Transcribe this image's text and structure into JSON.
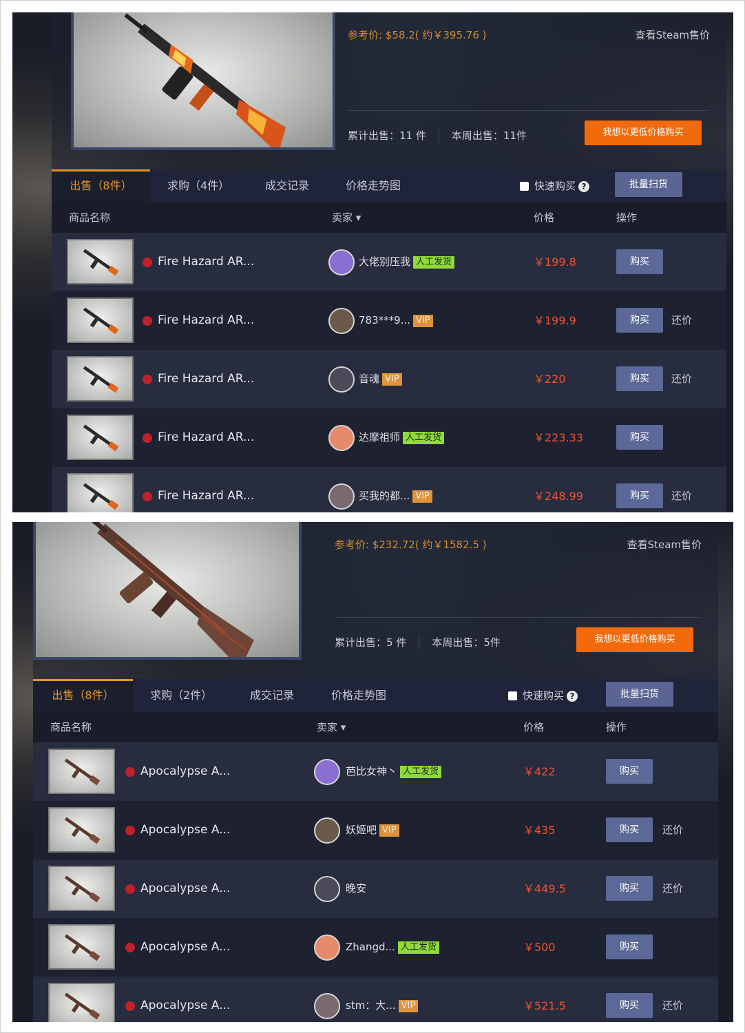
{
  "panel1": {
    "ref_price": "参考价: $58.2( 约￥395.76 )",
    "steam_link": "查看Steam售价",
    "total_sold": "累计出售：11 件",
    "week_sold": "本周出售：11件",
    "lowprice_btn": "我想以更低价格购买",
    "tabs": [
      "出售（8件）",
      "求购（4件）",
      "成交记录",
      "价格走势图"
    ],
    "quick_buy": "快速购买",
    "batch_btn": "批量扫货",
    "headers": {
      "name": "商品名称",
      "seller": "卖家 ▾",
      "price": "价格",
      "action": "操作"
    },
    "rows": [
      {
        "name": "Fire Hazard AR...",
        "seller": "大佬别压我",
        "badge": "人工发货",
        "badge_type": "manual",
        "price": "￥199.8",
        "buy": "购买",
        "haggle": ""
      },
      {
        "name": "Fire Hazard AR...",
        "seller": "783***9...",
        "badge": "VIP",
        "badge_type": "vip",
        "price": "￥199.9",
        "buy": "购买",
        "haggle": "还价"
      },
      {
        "name": "Fire Hazard AR...",
        "seller": "音魂",
        "badge": "VIP",
        "badge_type": "vip",
        "price": "￥220",
        "buy": "购买",
        "haggle": "还价"
      },
      {
        "name": "Fire Hazard AR...",
        "seller": "达摩祖师",
        "badge": "人工发货",
        "badge_type": "manual",
        "price": "￥223.33",
        "buy": "购买",
        "haggle": ""
      },
      {
        "name": "Fire Hazard AR...",
        "seller": "买我的都...",
        "badge": "VIP",
        "badge_type": "vip",
        "price": "￥248.99",
        "buy": "购买",
        "haggle": "还价"
      }
    ]
  },
  "panel2": {
    "ref_price": "参考价: $232.72( 约￥1582.5 )",
    "steam_link": "查看Steam售价",
    "total_sold": "累计出售：5 件",
    "week_sold": "本周出售：5件",
    "lowprice_btn": "我想以更低价格购买",
    "tabs": [
      "出售（8件）",
      "求购（2件）",
      "成交记录",
      "价格走势图"
    ],
    "quick_buy": "快速购买",
    "batch_btn": "批量扫货",
    "headers": {
      "name": "商品名称",
      "seller": "卖家 ▾",
      "price": "价格",
      "action": "操作"
    },
    "rows": [
      {
        "name": "Apocalypse A...",
        "seller": "芭比女神丶",
        "badge": "人工发货",
        "badge_type": "manual",
        "price": "￥422",
        "buy": "购买",
        "haggle": ""
      },
      {
        "name": "Apocalypse A...",
        "seller": "妖姬吧",
        "badge": "VIP",
        "badge_type": "vip",
        "price": "￥435",
        "buy": "购买",
        "haggle": "还价"
      },
      {
        "name": "Apocalypse A...",
        "seller": "晚安",
        "badge": "",
        "badge_type": "",
        "price": "￥449.5",
        "buy": "购买",
        "haggle": "还价"
      },
      {
        "name": "Apocalypse A...",
        "seller": "Zhangd...",
        "badge": "人工发货",
        "badge_type": "manual",
        "price": "￥500",
        "buy": "购买",
        "haggle": ""
      },
      {
        "name": "Apocalypse A...",
        "seller": "stm：大...",
        "badge": "VIP",
        "badge_type": "vip",
        "price": "￥521.5",
        "buy": "购买",
        "haggle": "还价"
      }
    ]
  },
  "colors": {
    "accent_orange": "#f26a0c",
    "tab_active": "#e5932c",
    "price_red": "#f0532e",
    "button_blue": "#5c6897",
    "badge_vip": "#f3a03b",
    "badge_manual": "#8fd93b"
  }
}
